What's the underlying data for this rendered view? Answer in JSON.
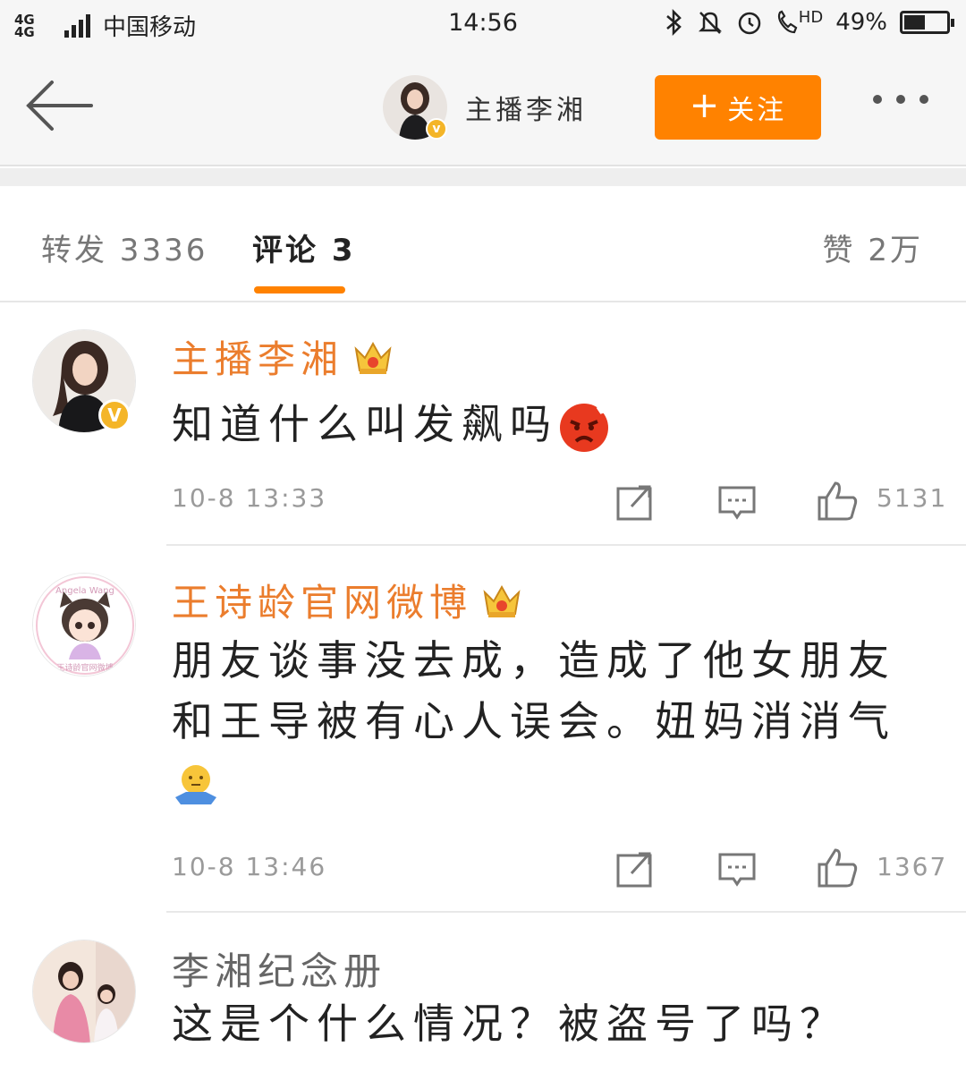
{
  "status_bar": {
    "network": "4G 4G",
    "carrier": "中国移动",
    "time": "14:56",
    "battery": "49%",
    "battery_level": 0.49,
    "icons": [
      "bluetooth-icon",
      "mute-icon",
      "alarm-icon",
      "hd-call-icon"
    ],
    "hd_label": "HD"
  },
  "nav": {
    "back_icon": "back-arrow-icon",
    "user_name": "主播李湘",
    "follow_label": "关注",
    "follow_plus": "+",
    "more_icon": "more-icon"
  },
  "tabs": {
    "repost": "转发 3336",
    "comments": "评论 3",
    "likes": "赞 2万"
  },
  "comments": [
    {
      "name": "主播李湘",
      "text": "知道什么叫发飙吗",
      "emoji": "angry-face-emoji",
      "time": "10-8 13:33",
      "likes": "5131",
      "verified": true,
      "badge": "crown-badge"
    },
    {
      "name": "王诗龄官网微博",
      "text": "朋友谈事没去成，造成了他女朋友和王导被有心人误会。妞妈消消气",
      "emoji": "shrug-emoji",
      "time": "10-8 13:46",
      "likes": "1367",
      "verified": false,
      "badge": "crown-badge",
      "avatar_text": "Angela Wang",
      "avatar_caption": "王诗龄官网微博"
    },
    {
      "name": "李湘纪念册",
      "text": "这是个什么情况？被盗号了吗？",
      "verified": false
    }
  ],
  "colors": {
    "accent": "#ff8200",
    "vip_name": "#eb7d2d",
    "verified": "#f4b528"
  }
}
